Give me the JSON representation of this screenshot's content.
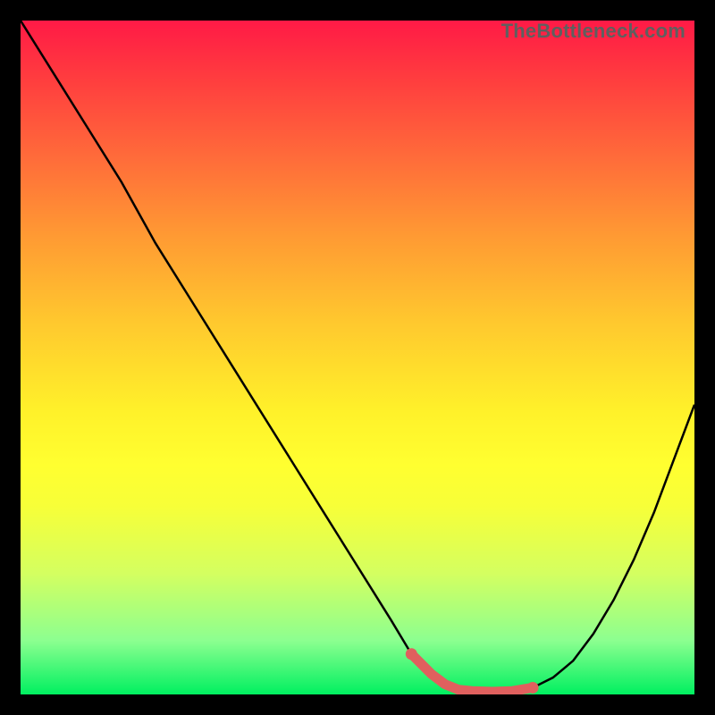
{
  "watermark": "TheBottleneck.com",
  "colors": {
    "frame": "#000000",
    "curve_stroke": "#000000",
    "indicator_fill": "#e0605e",
    "watermark_color": "#5f5f5f",
    "gradient_top": "#ff1a46",
    "gradient_bottom": "#00f060"
  },
  "chart_data": {
    "type": "line",
    "title": "",
    "xlabel": "",
    "ylabel": "",
    "xlim": [
      0,
      100
    ],
    "ylim": [
      0,
      100
    ],
    "grid": false,
    "legend": false,
    "series": [
      {
        "name": "bottleneck-curve",
        "x": [
          0,
          5,
          10,
          15,
          20,
          25,
          30,
          35,
          40,
          45,
          50,
          55,
          58,
          61,
          63,
          65,
          67,
          70,
          73,
          76,
          79,
          82,
          85,
          88,
          91,
          94,
          97,
          100
        ],
        "y": [
          100,
          92,
          84,
          76,
          67,
          59,
          51,
          43,
          35,
          27,
          19,
          11,
          6,
          3,
          1.5,
          0.7,
          0.5,
          0.4,
          0.5,
          1,
          2.5,
          5,
          9,
          14,
          20,
          27,
          35,
          43
        ]
      }
    ],
    "optimal_region": {
      "x": [
        58,
        61,
        63,
        65,
        67,
        70,
        73,
        76
      ],
      "y": [
        6,
        3,
        1.5,
        0.7,
        0.5,
        0.4,
        0.5,
        1
      ]
    },
    "annotations": []
  }
}
